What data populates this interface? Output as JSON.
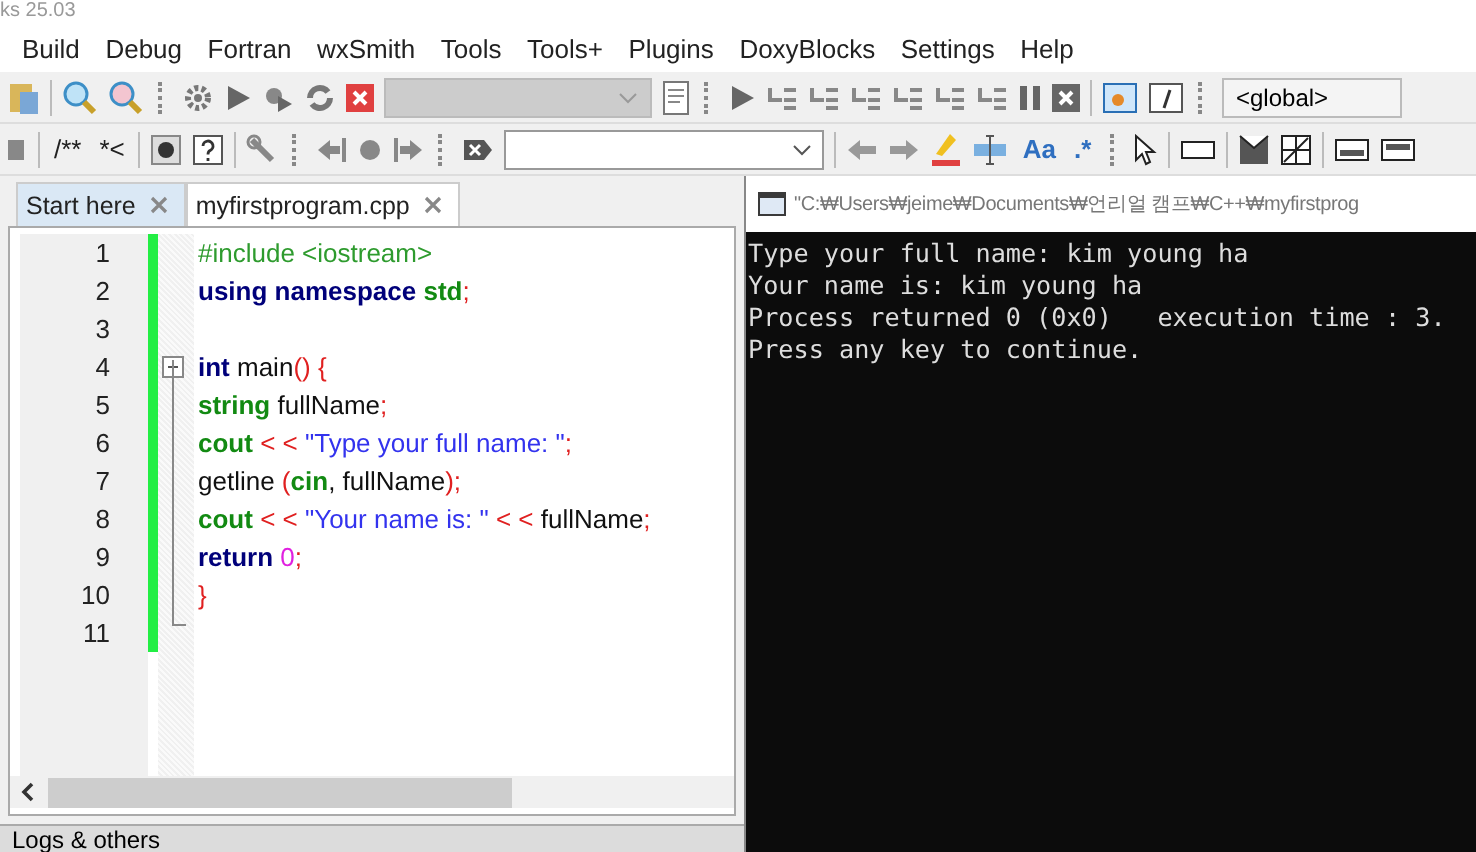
{
  "window": {
    "title": "ks 25.03"
  },
  "menu": [
    "Build",
    "Debug",
    "Fortran",
    "wxSmith",
    "Tools",
    "Tools+",
    "Plugins",
    "DoxyBlocks",
    "Settings",
    "Help"
  ],
  "toolbar": {
    "scope_dropdown": "<global>",
    "comment_buttons": [
      "/**",
      "*<"
    ],
    "text_buttons": [
      "Aa",
      ".*"
    ]
  },
  "editor": {
    "tabs": [
      {
        "label": "Start here",
        "selected": false
      },
      {
        "label": "myfirstprogram.cpp",
        "selected": true
      }
    ],
    "lines": [
      {
        "number": "1",
        "fold_start": false,
        "tokens": [
          {
            "kind": "preproc",
            "text": "#include <iostream>"
          }
        ]
      },
      {
        "number": "2",
        "fold_start": false,
        "tokens": [
          {
            "kind": "keyword",
            "text": "using namespace "
          },
          {
            "kind": "type",
            "text": "std"
          },
          {
            "kind": "operator",
            "text": ";"
          }
        ]
      },
      {
        "number": "3",
        "fold_start": false
      },
      {
        "number": "4",
        "fold_start": true,
        "tokens": [
          {
            "kind": "keyword",
            "text": "int"
          },
          {
            "kind": "plain",
            "text": " main"
          },
          {
            "kind": "operator",
            "text": "() {"
          }
        ]
      },
      {
        "number": "5",
        "fold_start": false,
        "tokens": [
          {
            "kind": "type",
            "text": "string"
          },
          {
            "kind": "plain",
            "text": " fullName"
          },
          {
            "kind": "operator",
            "text": ";"
          }
        ]
      },
      {
        "number": "6",
        "fold_start": false,
        "tokens": [
          {
            "kind": "type",
            "text": "cout"
          },
          {
            "kind": "operator",
            "text": " < < "
          },
          {
            "kind": "string",
            "text": "\"Type your full name: \""
          },
          {
            "kind": "operator",
            "text": ";"
          }
        ]
      },
      {
        "number": "7",
        "fold_start": false,
        "tokens": [
          {
            "kind": "plain",
            "text": "getline "
          },
          {
            "kind": "operator",
            "text": "("
          },
          {
            "kind": "type",
            "text": "cin"
          },
          {
            "kind": "plain",
            "text": ", fullName"
          },
          {
            "kind": "operator",
            "text": ");"
          }
        ]
      },
      {
        "number": "8",
        "fold_start": false,
        "tokens": [
          {
            "kind": "type",
            "text": "cout"
          },
          {
            "kind": "operator",
            "text": " < < "
          },
          {
            "kind": "string",
            "text": "\"Your name is: \""
          },
          {
            "kind": "operator",
            "text": " < < "
          },
          {
            "kind": "plain",
            "text": "fullName"
          },
          {
            "kind": "operator",
            "text": ";"
          }
        ]
      },
      {
        "number": "9",
        "fold_start": false,
        "tokens": [
          {
            "kind": "keyword",
            "text": "return "
          },
          {
            "kind": "number",
            "text": "0"
          },
          {
            "kind": "operator",
            "text": ";"
          }
        ]
      },
      {
        "number": "10",
        "fold_start": false,
        "tokens": [
          {
            "kind": "operator",
            "text": "}"
          }
        ]
      },
      {
        "number": "11",
        "fold_start": false
      }
    ]
  },
  "console": {
    "title": "\"C:₩Users₩jeime₩Documents₩언리얼 캠프₩C++₩myfirstprog",
    "lines": [
      "Type your full name: kim young ha",
      "Your name is: kim young ha",
      "Process returned 0 (0x0)   execution time : 3.",
      "Press any key to continue."
    ]
  },
  "bottom_panel": {
    "title": "Logs & others"
  }
}
